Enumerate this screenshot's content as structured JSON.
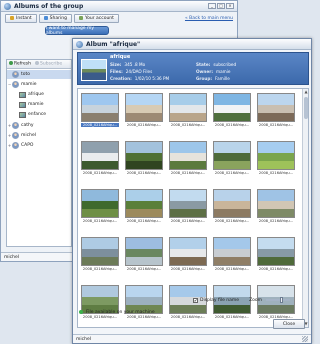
{
  "back_window": {
    "title": "Albums of the group",
    "controls": [
      "_",
      "□",
      "×"
    ],
    "tabs": [
      {
        "label": "Instant",
        "icon": "star-icon",
        "color": "#d9a428"
      },
      {
        "label": "Sharing",
        "icon": "share-icon",
        "color": "#4a8bd6"
      },
      {
        "label": "Your account",
        "icon": "account-icon",
        "color": "#7aa35a"
      }
    ],
    "back_link": "« Back to main menu",
    "manage_button": "I want to manage my albums",
    "toolbar": {
      "refresh": "Refresh",
      "subscribe": "Subscribe"
    },
    "tree": [
      {
        "label": "toto",
        "type": "user",
        "twisty": "",
        "selected": true
      },
      {
        "label": "mamie",
        "type": "user",
        "twisty": "−",
        "selected": false
      },
      {
        "label": "afrique",
        "type": "album",
        "twisty": "",
        "selected": false
      },
      {
        "label": "mamie",
        "type": "album",
        "twisty": "",
        "selected": false
      },
      {
        "label": "enfance",
        "type": "album",
        "twisty": "",
        "selected": false
      },
      {
        "label": "cathy",
        "type": "user",
        "twisty": "+",
        "selected": false
      },
      {
        "label": "michel",
        "type": "user",
        "twisty": "+",
        "selected": false
      },
      {
        "label": "CAPO",
        "type": "user",
        "twisty": "+",
        "selected": false
      }
    ],
    "status": "michel"
  },
  "dialog": {
    "title": "Album \"afrique\"",
    "album_name": "afrique",
    "info": {
      "size_label": "Size:",
      "size": "345 .8 Mo",
      "files_label": "Files:",
      "files": "24/DAO Files",
      "creation_label": "Creation:",
      "creation": "1/02/10 5:36 PM",
      "state_label": "State:",
      "state": "subscribed",
      "owner_label": "Owner:",
      "owner": "mamie",
      "group_label": "Group:",
      "group": "Famille"
    },
    "thumbnails": [
      {
        "caption": "2008_0216Afriqu...",
        "colors": [
          "#9ec7ef",
          "#c7d3dc",
          "#8a7f6e"
        ],
        "selected": true
      },
      {
        "caption": "2008_0216Afriqu...",
        "colors": [
          "#b5d6f4",
          "#d8cbb4",
          "#9d8a74"
        ],
        "selected": false
      },
      {
        "caption": "2008_0216Afriqu...",
        "colors": [
          "#a7cde9",
          "#e3e7ea",
          "#b9a58a"
        ],
        "selected": false
      },
      {
        "caption": "2008_0216Afriqu...",
        "colors": [
          "#7fb6e3",
          "#f1f3f5",
          "#4f6f3e"
        ],
        "selected": false
      },
      {
        "caption": "2008_0216Afriqu...",
        "colors": [
          "#bcd6ee",
          "#c9bfb1",
          "#7c6a58"
        ],
        "selected": false
      },
      {
        "caption": "2008_0216Afriqu...",
        "colors": [
          "#8fa0ad",
          "#e9ecee",
          "#3d5a2f"
        ],
        "selected": false
      },
      {
        "caption": "2008_0216Afriqu...",
        "colors": [
          "#a3c2dd",
          "#4f7034",
          "#2f4420"
        ],
        "selected": false
      },
      {
        "caption": "2008_0216Afriqu...",
        "colors": [
          "#9dc6ea",
          "#e6e3dc",
          "#5b7a3e"
        ],
        "selected": false
      },
      {
        "caption": "2008_0216Afriqu...",
        "colors": [
          "#b9d4ea",
          "#4e6b3a",
          "#8aa35d"
        ],
        "selected": false
      },
      {
        "caption": "2008_0216Afriqu...",
        "colors": [
          "#a6cdf0",
          "#7aa54c",
          "#9ec25a"
        ],
        "selected": false
      },
      {
        "caption": "2008_0216Afriqu...",
        "colors": [
          "#8fb9dc",
          "#3f6a2e",
          "#6e8f45"
        ],
        "selected": false
      },
      {
        "caption": "2008_0216Afriqu...",
        "colors": [
          "#abcfe9",
          "#5a7f3a",
          "#9c8a5c"
        ],
        "selected": false
      },
      {
        "caption": "2008_0216Afriqu...",
        "colors": [
          "#c2dbef",
          "#8a9aa3",
          "#5d6f45"
        ],
        "selected": false
      },
      {
        "caption": "2008_0216Afriqu...",
        "colors": [
          "#b8d2ea",
          "#c9b59a",
          "#8c7a62"
        ],
        "selected": false
      },
      {
        "caption": "2008_0216Afriqu...",
        "colors": [
          "#9fc3e5",
          "#d1c6b4",
          "#7e8a66"
        ],
        "selected": false
      },
      {
        "caption": "2008_0216Afriqu...",
        "colors": [
          "#aecbe4",
          "#7d8f9d",
          "#6c7b58"
        ],
        "selected": false
      },
      {
        "caption": "2008_0216Afriqu...",
        "colors": [
          "#9dbde0",
          "#6a8760",
          "#b7c4cc"
        ],
        "selected": false
      },
      {
        "caption": "2008_0216Afriqu...",
        "colors": [
          "#b2d0ea",
          "#e6e8ea",
          "#7d6a52"
        ],
        "selected": false
      },
      {
        "caption": "2008_0216Afriqu...",
        "colors": [
          "#a4c8ea",
          "#c8cdd2",
          "#8f7e66"
        ],
        "selected": false
      },
      {
        "caption": "2008_0216Afriqu...",
        "colors": [
          "#c4dcef",
          "#879aa6",
          "#4f6a3a"
        ],
        "selected": false
      },
      {
        "caption": "2008_0216Afriqu...",
        "colors": [
          "#b0c9de",
          "#7d9a62",
          "#5f7d43"
        ],
        "selected": false
      },
      {
        "caption": "2008_0216Afriqu...",
        "colors": [
          "#b9d5ee",
          "#9cb0bf",
          "#6f8752"
        ],
        "selected": false
      },
      {
        "caption": "2008_0216Afriqu...",
        "colors": [
          "#a6c9ea",
          "#d6d9dc",
          "#6c7e57"
        ],
        "selected": false
      },
      {
        "caption": "2008_0216Afriqu...",
        "colors": [
          "#c2d9ec",
          "#8ba2b2",
          "#3f5a30"
        ],
        "selected": false
      },
      {
        "caption": "2008_0216Afriqu...",
        "colors": [
          "#d7e2ea",
          "#9fb1bd",
          "#6a7a60"
        ],
        "selected": false
      }
    ],
    "display_file_name": "Display file name",
    "display_file_name_checked": true,
    "zoom_label": "Zoom",
    "available_text": "File available on your machine",
    "close_button": "Close",
    "status": "michel"
  }
}
